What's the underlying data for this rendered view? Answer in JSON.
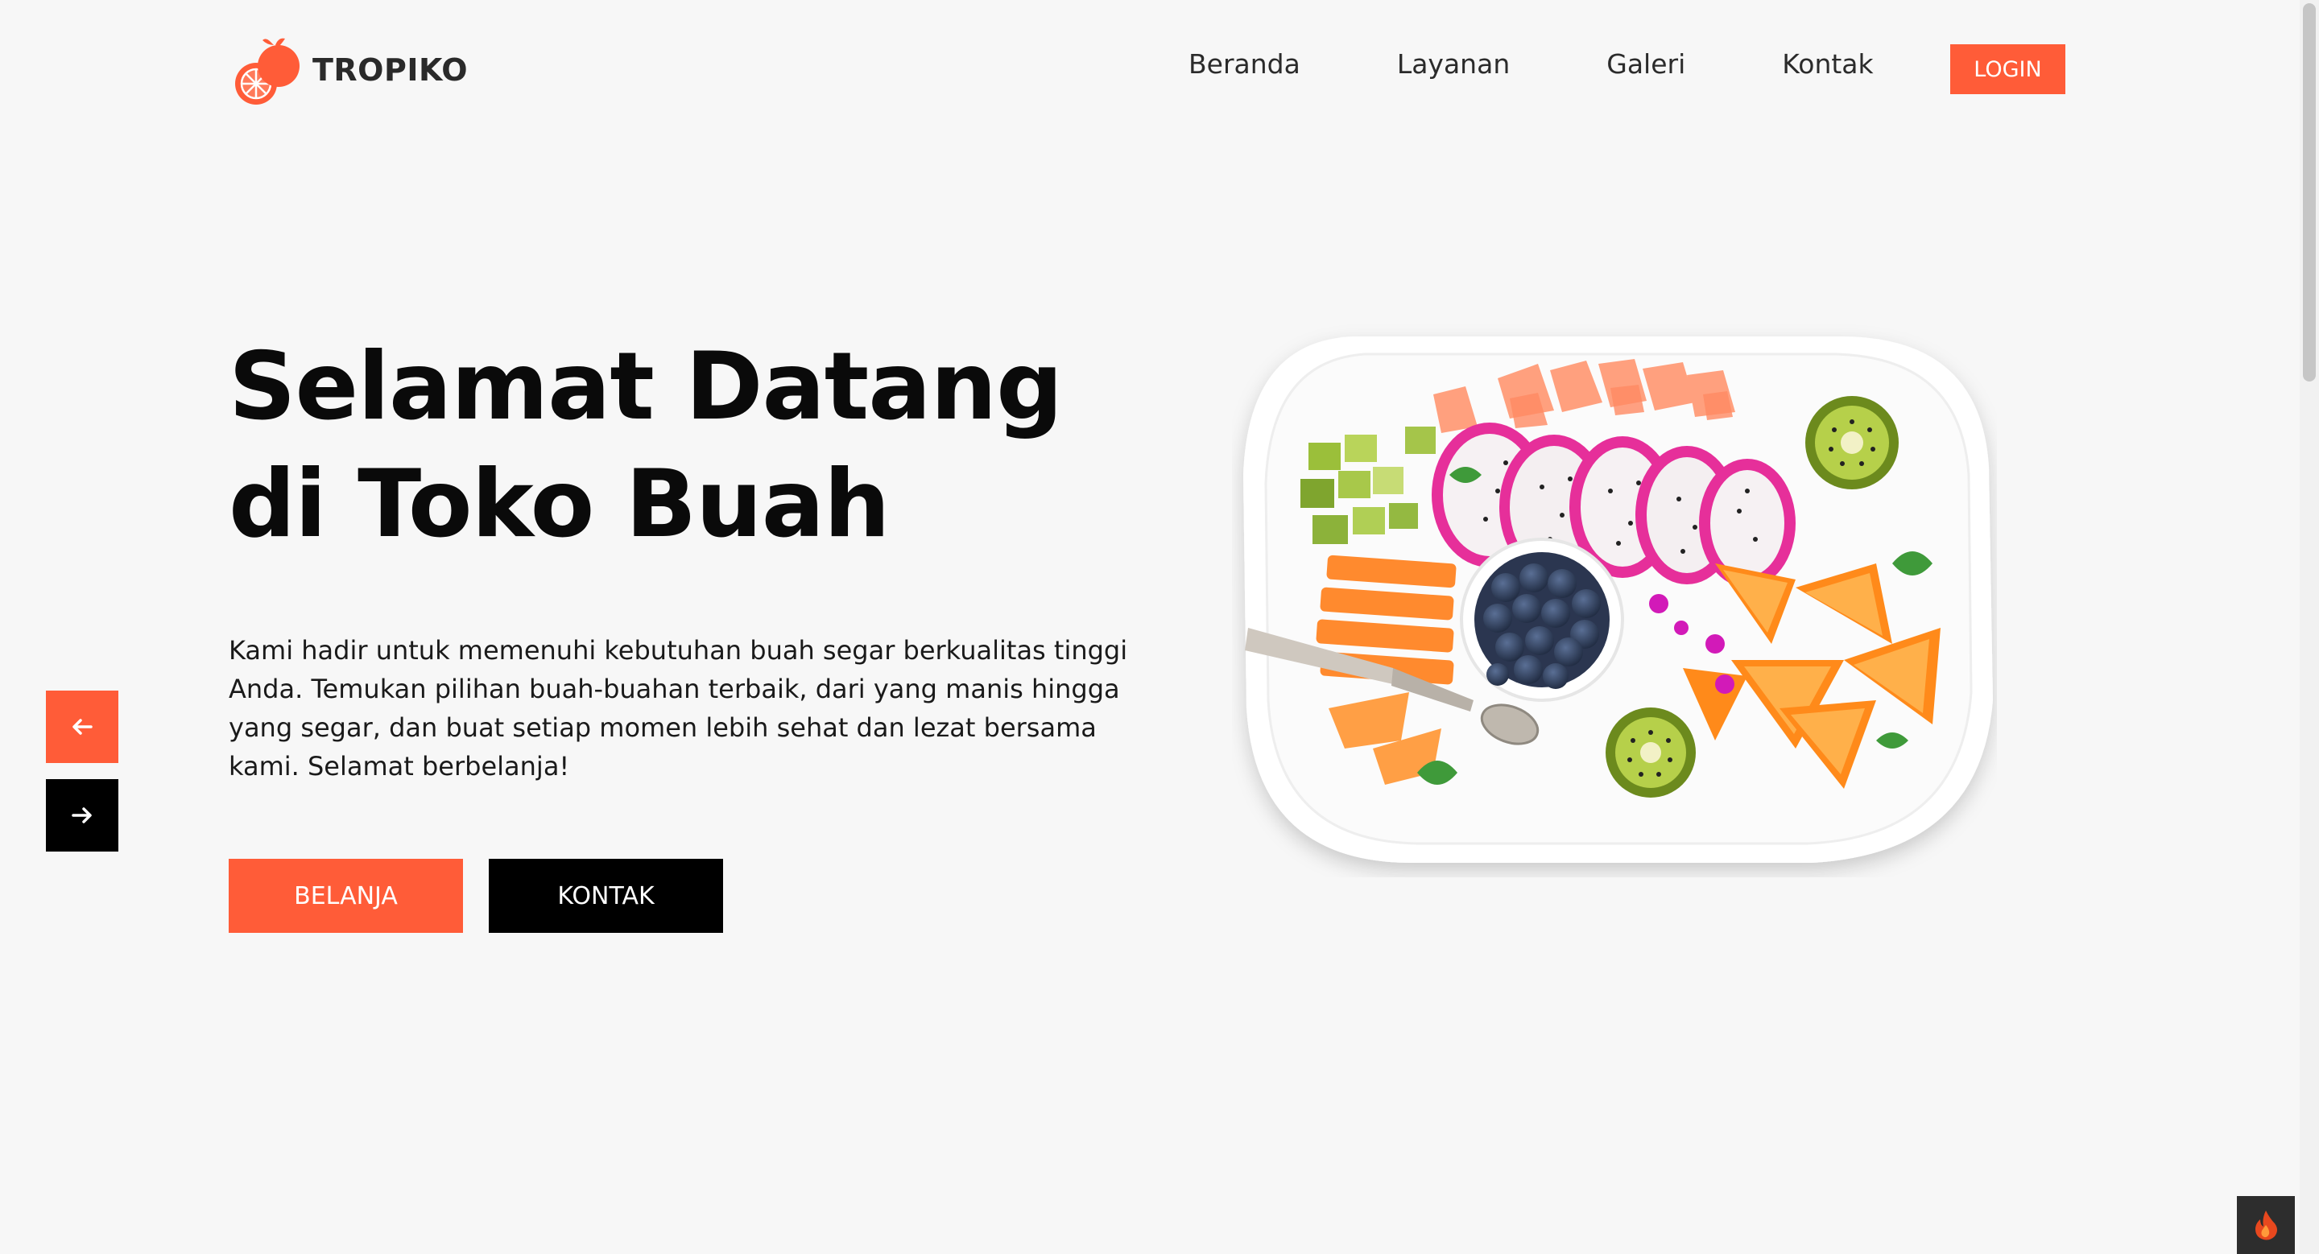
{
  "brand": {
    "name": "TROPIKO",
    "accent": "#ff5c38"
  },
  "nav": {
    "items": [
      {
        "label": "Beranda"
      },
      {
        "label": "Layanan"
      },
      {
        "label": "Galeri"
      },
      {
        "label": "Kontak"
      }
    ],
    "login_label": "LOGIN"
  },
  "hero": {
    "title_line1": "Selamat Datang",
    "title_line2": "di Toko Buah",
    "description": "Kami hadir untuk memenuhi kebutuhan buah segar berkualitas tinggi Anda. Temukan pilihan buah-buahan terbaik, dari yang manis hingga yang segar, dan buat setiap momen lebih sehat dan lezat bersama kami. Selamat berbelanja!",
    "primary_button": "BELANJA",
    "secondary_button": "KONTAK"
  },
  "icons": {
    "prev": "arrow-left-icon",
    "next": "arrow-right-icon",
    "logo": "orange-fruit-icon",
    "corner": "flame-icon"
  }
}
